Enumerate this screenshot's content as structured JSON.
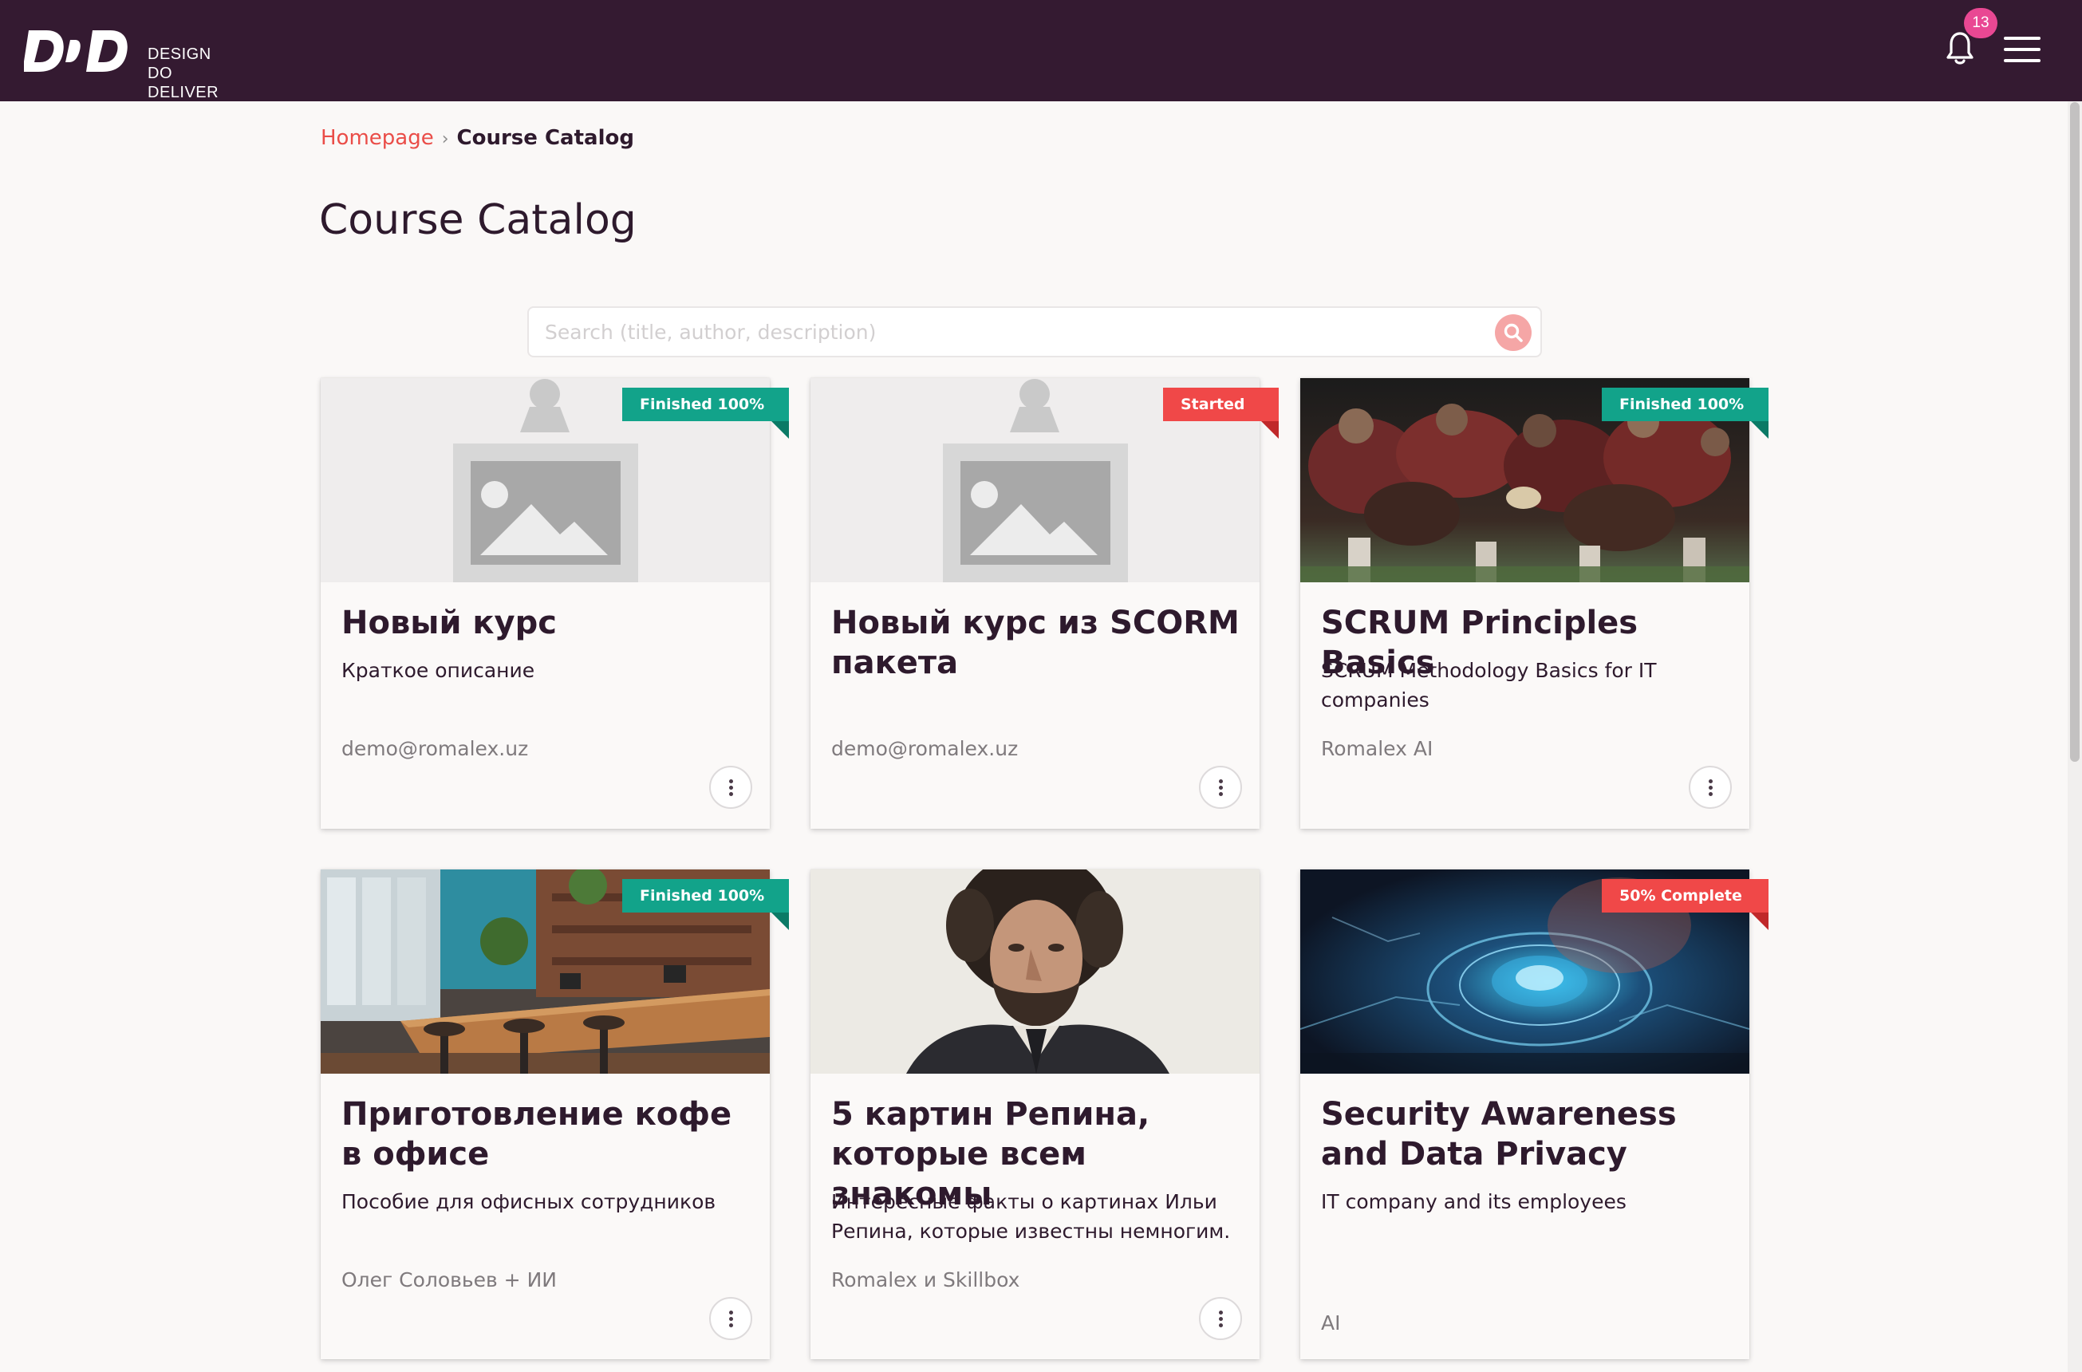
{
  "header": {
    "logo_lines": [
      "DESIGN",
      "DO",
      "DELIVER"
    ],
    "notification_count": "13",
    "icons": {
      "bell": "bell-icon",
      "menu": "hamburger-menu-icon"
    },
    "colors": {
      "background": "#341a31",
      "badge": "#e94893"
    }
  },
  "breadcrumb": {
    "home": "Homepage",
    "separator": "›",
    "current": "Course Catalog"
  },
  "page": {
    "title": "Course Catalog"
  },
  "search": {
    "placeholder": "Search (title, author, description)",
    "value": "",
    "button_icon": "search-icon"
  },
  "colors": {
    "accent": "#ea4d48",
    "finished": "#12a38a",
    "in_progress": "#f04848",
    "text": "#2e1a2d"
  },
  "cards": [
    {
      "title": "Новый курс",
      "description": "Краткое описание",
      "author": "demo@romalex.uz",
      "status": "Finished 100%",
      "status_color": "#12a38a",
      "image": "placeholder-image-icon"
    },
    {
      "title": "Новый курс из SCORM пакета",
      "description": "",
      "author": "demo@romalex.uz",
      "status": "Started",
      "status_color": "#f04848",
      "image": "placeholder-image-icon"
    },
    {
      "title": "SCRUM Principles Basics",
      "description": "SCRUM Methodology Basics for IT companies",
      "author": "Romalex AI",
      "status": "Finished 100%",
      "status_color": "#12a38a",
      "image": "rugby-scrum-photo"
    },
    {
      "title": "Приготовление кофе в офисе",
      "description": "Пособие для офисных сотрудников",
      "author": "Олег Соловьев + ИИ",
      "status": "Finished 100%",
      "status_color": "#12a38a",
      "image": "office-cafe-photo"
    },
    {
      "title": "5 картин Репина, которые всем знакомы",
      "description": "Интересные факты о картинах Ильи Репина, которые известны немногим.",
      "author": "Romalex и Skillbox",
      "status": "",
      "status_color": "",
      "image": "repin-portrait-painting"
    },
    {
      "title": "Security Awareness and Data Privacy",
      "description": "IT company and its employees",
      "author": "AI",
      "status": "50% Complete",
      "status_color": "#f04848",
      "image": "cyber-security-illustration"
    }
  ]
}
